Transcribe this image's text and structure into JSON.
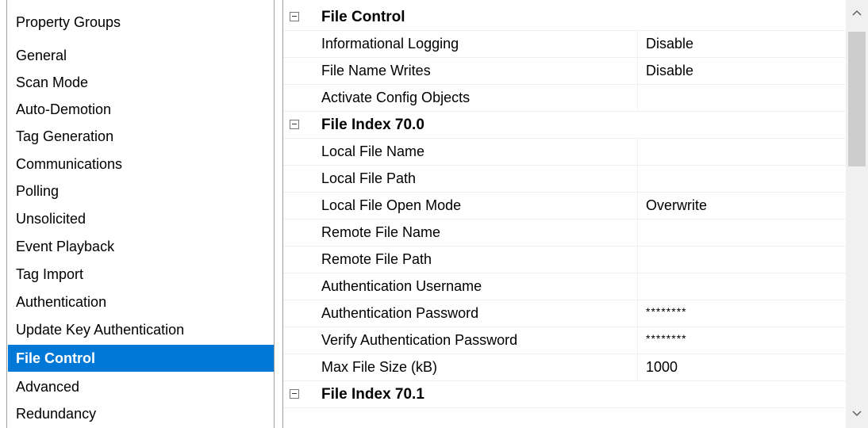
{
  "property_groups": {
    "heading": "Property Groups",
    "items": [
      {
        "label": "General",
        "selected": false
      },
      {
        "label": "Scan Mode",
        "selected": false
      },
      {
        "label": "Auto-Demotion",
        "selected": false
      },
      {
        "label": "Tag Generation",
        "selected": false
      },
      {
        "label": "Communications",
        "selected": false
      },
      {
        "label": "Polling",
        "selected": false
      },
      {
        "label": "Unsolicited",
        "selected": false
      },
      {
        "label": "Event Playback",
        "selected": false
      },
      {
        "label": "Tag Import",
        "selected": false
      },
      {
        "label": "Authentication",
        "selected": false
      },
      {
        "label": "Update Key Authentication",
        "selected": false
      },
      {
        "label": "File Control",
        "selected": true
      },
      {
        "label": "Advanced",
        "selected": false
      },
      {
        "label": "Redundancy",
        "selected": false
      }
    ]
  },
  "properties": {
    "file_control": {
      "title": "File Control",
      "rows": [
        {
          "name": "Informational Logging",
          "value": "Disable"
        },
        {
          "name": "File Name Writes",
          "value": "Disable"
        },
        {
          "name": "Activate Config Objects",
          "value": ""
        }
      ]
    },
    "file_index_70_0": {
      "title": "File Index 70.0",
      "rows": [
        {
          "name": "Local File Name",
          "value": ""
        },
        {
          "name": "Local File Path",
          "value": ""
        },
        {
          "name": "Local File Open Mode",
          "value": "Overwrite"
        },
        {
          "name": "Remote File Name",
          "value": ""
        },
        {
          "name": "Remote File Path",
          "value": ""
        },
        {
          "name": "Authentication Username",
          "value": ""
        },
        {
          "name": "Authentication Password",
          "value": "********"
        },
        {
          "name": "Verify Authentication Password",
          "value": "********"
        },
        {
          "name": "Max File Size (kB)",
          "value": "1000"
        }
      ]
    },
    "file_index_70_1": {
      "title": "File Index 70.1"
    }
  },
  "scrollbar": {
    "up_icon": "chevron-up-icon",
    "down_icon": "chevron-down-icon"
  },
  "colors": {
    "selection": "#0078d7",
    "grid_line": "#f0f0f0",
    "scroll_track": "#f0f0f0",
    "scroll_thumb": "#cdcdcd"
  }
}
